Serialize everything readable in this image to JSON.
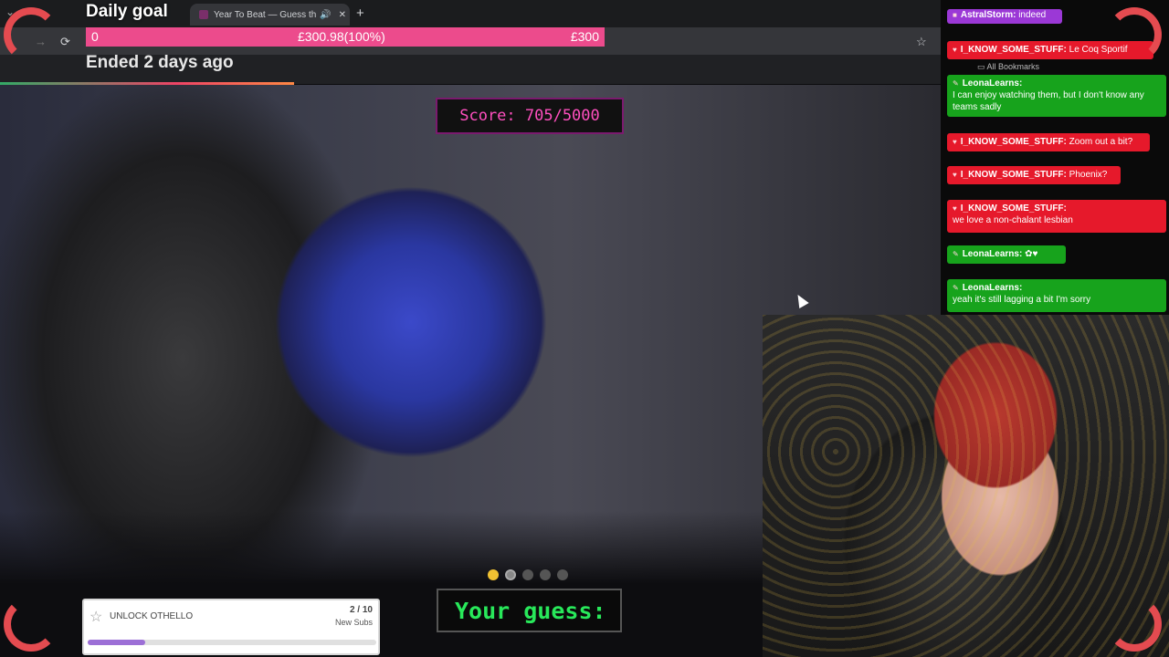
{
  "browser": {
    "tab_title": "Year To Beat — Guess the S",
    "new_tab_icon": "+",
    "bookmarks_label": "All Bookmarks"
  },
  "goal": {
    "title": "Daily goal",
    "start": "0",
    "current": "£300.98(100%)",
    "target": "£300",
    "status": "Ended 2 days ago",
    "progress_fraction": 1.0,
    "bar_color": "#ec4b8c"
  },
  "game": {
    "score": "Score: 705/5000",
    "guess_label": "Your guess:",
    "round_dots": 5,
    "current_round": 1
  },
  "subs_widget": {
    "label": "UNLOCK OTHELLO",
    "count": "2 / 10",
    "sublabel": "New Subs",
    "progress_fraction": 0.2
  },
  "chat": {
    "messages": [
      {
        "user": "AstralStorm:",
        "text": "indeed",
        "color": "purple"
      },
      {
        "user": "I_KNOW_SOME_STUFF:",
        "text": "Le Coq Sportif",
        "color": "red"
      },
      {
        "user": "LeonaLearns:",
        "text": "I can enjoy watching them, but I don't know any teams sadly",
        "color": "green"
      },
      {
        "user": "I_KNOW_SOME_STUFF:",
        "text": "Zoom out a bit?",
        "color": "red"
      },
      {
        "user": "I_KNOW_SOME_STUFF:",
        "text": "Phoenix?",
        "color": "red"
      },
      {
        "user": "I_KNOW_SOME_STUFF:",
        "text": "we love a non-chalant lesbian",
        "color": "red"
      },
      {
        "user": "LeonaLearns:",
        "text": "",
        "color": "green"
      },
      {
        "user": "LeonaLearns:",
        "text": "yeah it's still lagging a bit I'm sorry",
        "color": "green"
      }
    ]
  },
  "colors": {
    "chat_red": "#e6192b",
    "chat_green": "#17a31c",
    "chat_purple": "#9b38d6",
    "score_text": "#ff4fbf",
    "guess_text": "#28e85a"
  }
}
